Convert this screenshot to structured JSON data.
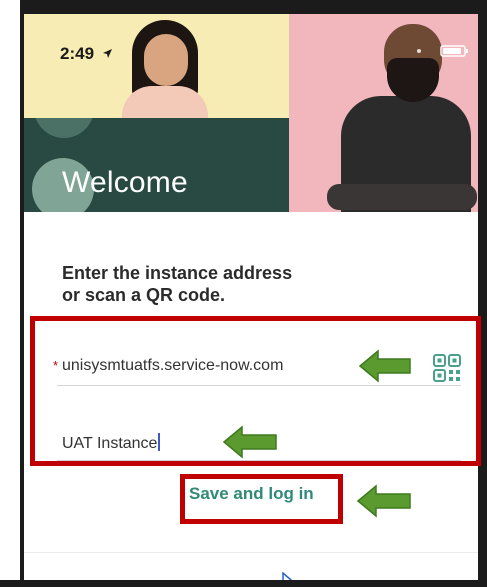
{
  "status_bar": {
    "time": "2:49"
  },
  "hero": {
    "title": "Welcome"
  },
  "form": {
    "prompt_line1": "Enter the instance address",
    "prompt_line2": "or scan a QR code.",
    "instance_url": "unisysmtuatfs.service-now.com",
    "instance_name": "UAT Instance",
    "save_label": "Save and log in"
  },
  "icons": {
    "location": "location-arrow-icon",
    "qr": "qr-code-icon",
    "annotation_arrow": "green-arrow-icon",
    "cursor": "mouse-pointer-icon"
  },
  "colors": {
    "hero_yellow": "#f7ecb3",
    "hero_dark_green": "#284a43",
    "hero_pink": "#f1b7bd",
    "link_green": "#2f8a76",
    "annotation_red": "#c00000",
    "annotation_arrow_green": "#5a9a2e"
  }
}
